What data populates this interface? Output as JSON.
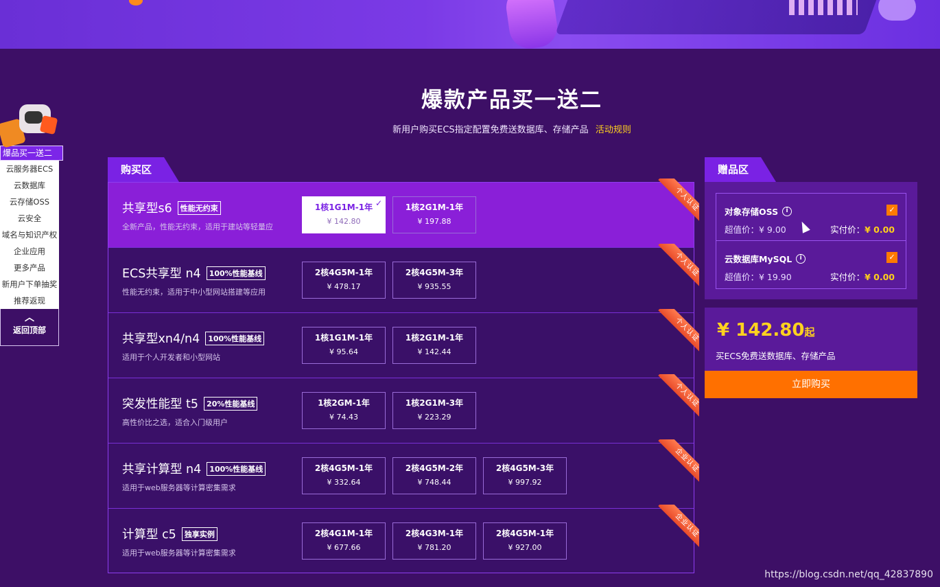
{
  "header": {
    "headline": "爆款产品买一送二",
    "subline": "新用户购买ECS指定配置免费送数据库、存储产品",
    "rules_link": "活动规则"
  },
  "sidenav": {
    "active": "爆品买一送二",
    "items": [
      "云服务器ECS",
      "云数据库",
      "云存储OSS",
      "云安全",
      "域名与知识产权",
      "企业应用",
      "更多产品",
      "新用户下单抽奖",
      "推荐返现"
    ],
    "back_top": "返回顶部"
  },
  "buy": {
    "tab_label": "购买区",
    "rows": [
      {
        "name": "共享型s6",
        "badge": "性能无约束",
        "desc": "全新产品，性能无约束，适用于建站等轻量应",
        "ribbon": "个人认证",
        "options": [
          {
            "spec": "1核1G1M-1年",
            "price": "¥ 142.80"
          },
          {
            "spec": "1核2G1M-1年",
            "price": "¥ 197.88"
          }
        ]
      },
      {
        "name": "ECS共享型 n4",
        "badge": "100%性能基线",
        "desc": "性能无约束，适用于中小型网站搭建等应用",
        "ribbon": "个人认证",
        "options": [
          {
            "spec": "2核4G5M-1年",
            "price": "¥ 478.17"
          },
          {
            "spec": "2核4G5M-3年",
            "price": "¥ 935.55"
          }
        ]
      },
      {
        "name": "共享型xn4/n4",
        "badge": "100%性能基线",
        "desc": "适用于个人开发者和小型网站",
        "ribbon": "个人认证",
        "options": [
          {
            "spec": "1核1G1M-1年",
            "price": "¥ 95.64"
          },
          {
            "spec": "1核2G1M-1年",
            "price": "¥ 142.44"
          }
        ]
      },
      {
        "name": "突发性能型 t5",
        "badge": "20%性能基线",
        "desc": "高性价比之选，适合入门级用户",
        "ribbon": "个人认证",
        "options": [
          {
            "spec": "1核2GM-1年",
            "price": "¥ 74.43"
          },
          {
            "spec": "1核2G1M-3年",
            "price": "¥ 223.29"
          }
        ]
      },
      {
        "name": "共享计算型 n4",
        "badge": "100%性能基线",
        "desc": "适用于web服务器等计算密集需求",
        "ribbon": "企业认证",
        "options": [
          {
            "spec": "2核4G5M-1年",
            "price": "¥ 332.64"
          },
          {
            "spec": "2核4G5M-2年",
            "price": "¥ 748.44"
          },
          {
            "spec": "2核4G5M-3年",
            "price": "¥ 997.92"
          }
        ]
      },
      {
        "name": "计算型 c5",
        "badge": "独享实例",
        "desc": "适用于web服务器等计算密集需求",
        "ribbon": "企业认证",
        "options": [
          {
            "spec": "2核4G1M-1年",
            "price": "¥ 677.66"
          },
          {
            "spec": "2核4G3M-1年",
            "price": "¥ 781.20"
          },
          {
            "spec": "2核4G5M-1年",
            "price": "¥ 927.00"
          }
        ]
      }
    ]
  },
  "gift": {
    "tab_label": "赠品区",
    "items": [
      {
        "name": "对象存储OSS",
        "orig": "超值价：¥ 9.00",
        "real_label": "实付价：",
        "real_value": "¥ 0.00"
      },
      {
        "name": "云数据库MySQL",
        "orig": "超值价：¥ 19.90",
        "real_label": "实付价：",
        "real_value": "¥ 0.00"
      }
    ]
  },
  "summary": {
    "total": "¥ 142.80",
    "suffix": "起",
    "note": "买ECS免费送数据库、存储产品",
    "buy_button": "立即购买"
  },
  "watermark": "https://blog.csdn.net/qq_42837890"
}
